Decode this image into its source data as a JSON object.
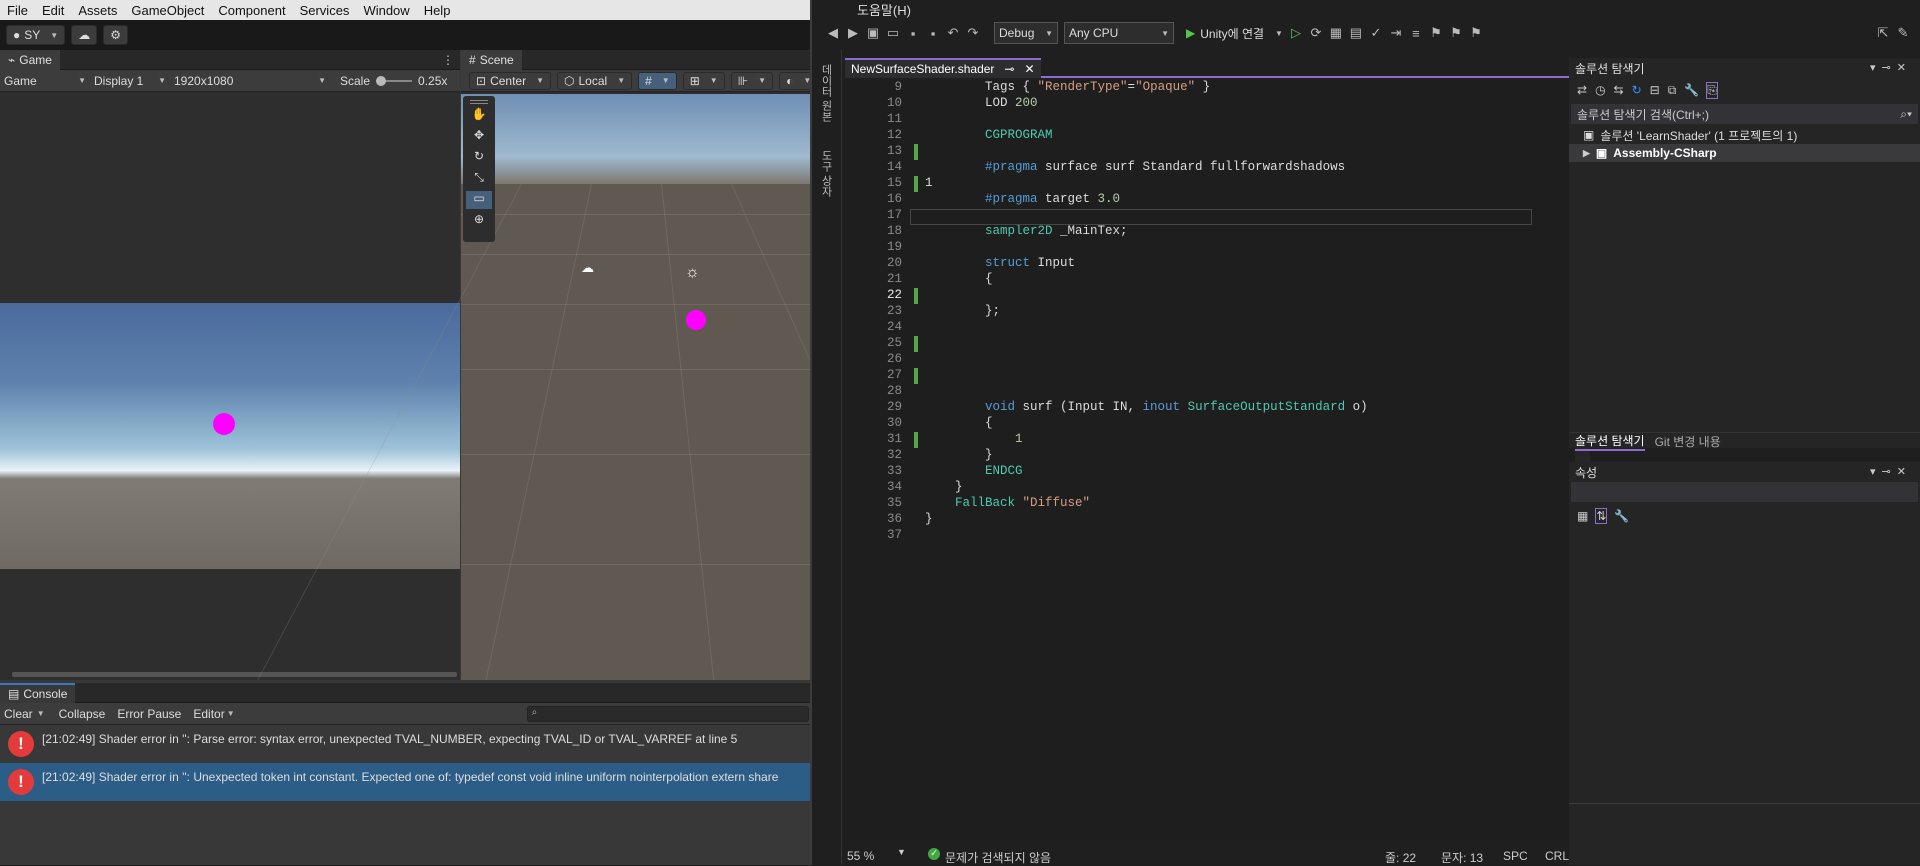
{
  "unity": {
    "menu": [
      "File",
      "Edit",
      "Assets",
      "GameObject",
      "Component",
      "Services",
      "Window",
      "Help"
    ],
    "account": "SY",
    "game_tab": "Game",
    "scene_tab": "Scene",
    "game_controls": {
      "view": "Game",
      "display": "Display 1",
      "resolution": "1920x1080",
      "scale_label": "Scale",
      "scale_value": "0.25x"
    },
    "scene_controls": {
      "pivot": "Center",
      "space": "Local"
    },
    "console": {
      "tab": "Console",
      "clear": "Clear",
      "collapse": "Collapse",
      "error_pause": "Error Pause",
      "editor": "Editor",
      "messages": [
        "[21:02:49] Shader error in '': Parse error: syntax error, unexpected TVAL_NUMBER, expecting TVAL_ID or TVAL_VARREF at line 5",
        "[21:02:49] Shader error in '': Unexpected token int constant. Expected one of: typedef const void inline uniform nointerpolation extern share"
      ]
    },
    "colors": {
      "sphere": "#ff00ff",
      "selected_row": "#2c5d87",
      "error_icon": "#e33b3b"
    }
  },
  "vs": {
    "menu_help": "도움말(H)",
    "config": "Debug",
    "platform": "Any CPU",
    "run_label": "Unity에 연결",
    "side_labels": [
      "데이터 원본",
      "도구 상자"
    ],
    "file_tab": "NewSurfaceShader.shader",
    "code": [
      {
        "n": "9",
        "parts": [
          [
            "",
            "        "
          ],
          [
            "",
            "Tags { "
          ],
          [
            "str",
            "\"RenderType\""
          ],
          [
            "",
            "="
          ],
          [
            "str",
            "\"Opaque\""
          ],
          [
            "",
            " }"
          ]
        ]
      },
      {
        "n": "10",
        "parts": [
          [
            "",
            "        LOD "
          ],
          [
            "num",
            "200"
          ]
        ]
      },
      {
        "n": "11",
        "parts": []
      },
      {
        "n": "12",
        "parts": [
          [
            "cg",
            "        CGPROGRAM"
          ]
        ]
      },
      {
        "n": "13",
        "parts": []
      },
      {
        "n": "14",
        "parts": [
          [
            "kw",
            "        #pragma"
          ],
          [
            "",
            " surface surf Standard fullforwardshadows"
          ]
        ]
      },
      {
        "n": "15",
        "parts": [
          [
            "",
            "1"
          ]
        ]
      },
      {
        "n": "16",
        "parts": [
          [
            "kw",
            "        #pragma"
          ],
          [
            "",
            " target "
          ],
          [
            "num",
            "3.0"
          ]
        ]
      },
      {
        "n": "17",
        "parts": []
      },
      {
        "n": "18",
        "parts": [
          [
            "cg",
            "        sampler2D"
          ],
          [
            "",
            " _MainTex;"
          ]
        ]
      },
      {
        "n": "19",
        "parts": []
      },
      {
        "n": "20",
        "parts": [
          [
            "kw",
            "        struct"
          ],
          [
            "",
            " Input"
          ]
        ]
      },
      {
        "n": "21",
        "parts": [
          [
            "",
            "        {"
          ]
        ]
      },
      {
        "n": "22",
        "parts": []
      },
      {
        "n": "23",
        "parts": [
          [
            "",
            "        };"
          ]
        ]
      },
      {
        "n": "24",
        "parts": []
      },
      {
        "n": "25",
        "parts": []
      },
      {
        "n": "26",
        "parts": []
      },
      {
        "n": "27",
        "parts": []
      },
      {
        "n": "28",
        "parts": []
      },
      {
        "n": "29",
        "parts": [
          [
            "kw",
            "        void"
          ],
          [
            "",
            " surf (Input IN, "
          ],
          [
            "kw",
            "inout"
          ],
          [
            "",
            " "
          ],
          [
            "cg",
            "SurfaceOutputStandard"
          ],
          [
            "",
            " o)"
          ]
        ]
      },
      {
        "n": "30",
        "parts": [
          [
            "",
            "        {"
          ]
        ]
      },
      {
        "n": "31",
        "parts": [
          [
            "num",
            "            1"
          ]
        ]
      },
      {
        "n": "32",
        "parts": [
          [
            "",
            "        }"
          ]
        ]
      },
      {
        "n": "33",
        "parts": [
          [
            "cg",
            "        ENDCG"
          ]
        ]
      },
      {
        "n": "34",
        "parts": [
          [
            "",
            "    }"
          ]
        ]
      },
      {
        "n": "35",
        "parts": [
          [
            "cg",
            "    FallBack"
          ],
          [
            "",
            " "
          ],
          [
            "str",
            "\"Diffuse\""
          ]
        ]
      },
      {
        "n": "36",
        "parts": [
          [
            "",
            "}"
          ]
        ]
      },
      {
        "n": "37",
        "parts": []
      }
    ],
    "status": {
      "zoom": "55 %",
      "issues": "문제가 검색되지 않음",
      "line": "줄: 22",
      "char": "문자: 13",
      "spc": "SPC",
      "eol": "CRLF"
    },
    "solution_explorer": {
      "title": "솔루션 탐색기",
      "search": "솔루션 탐색기 검색(Ctrl+;)",
      "solution": "솔루션 'LearnShader' (1 프로젝트의 1)",
      "project": "Assembly-CSharp",
      "tab1": "솔루션 탐색기",
      "tab2": "Git 변경 내용"
    },
    "properties": {
      "title": "속성"
    }
  }
}
